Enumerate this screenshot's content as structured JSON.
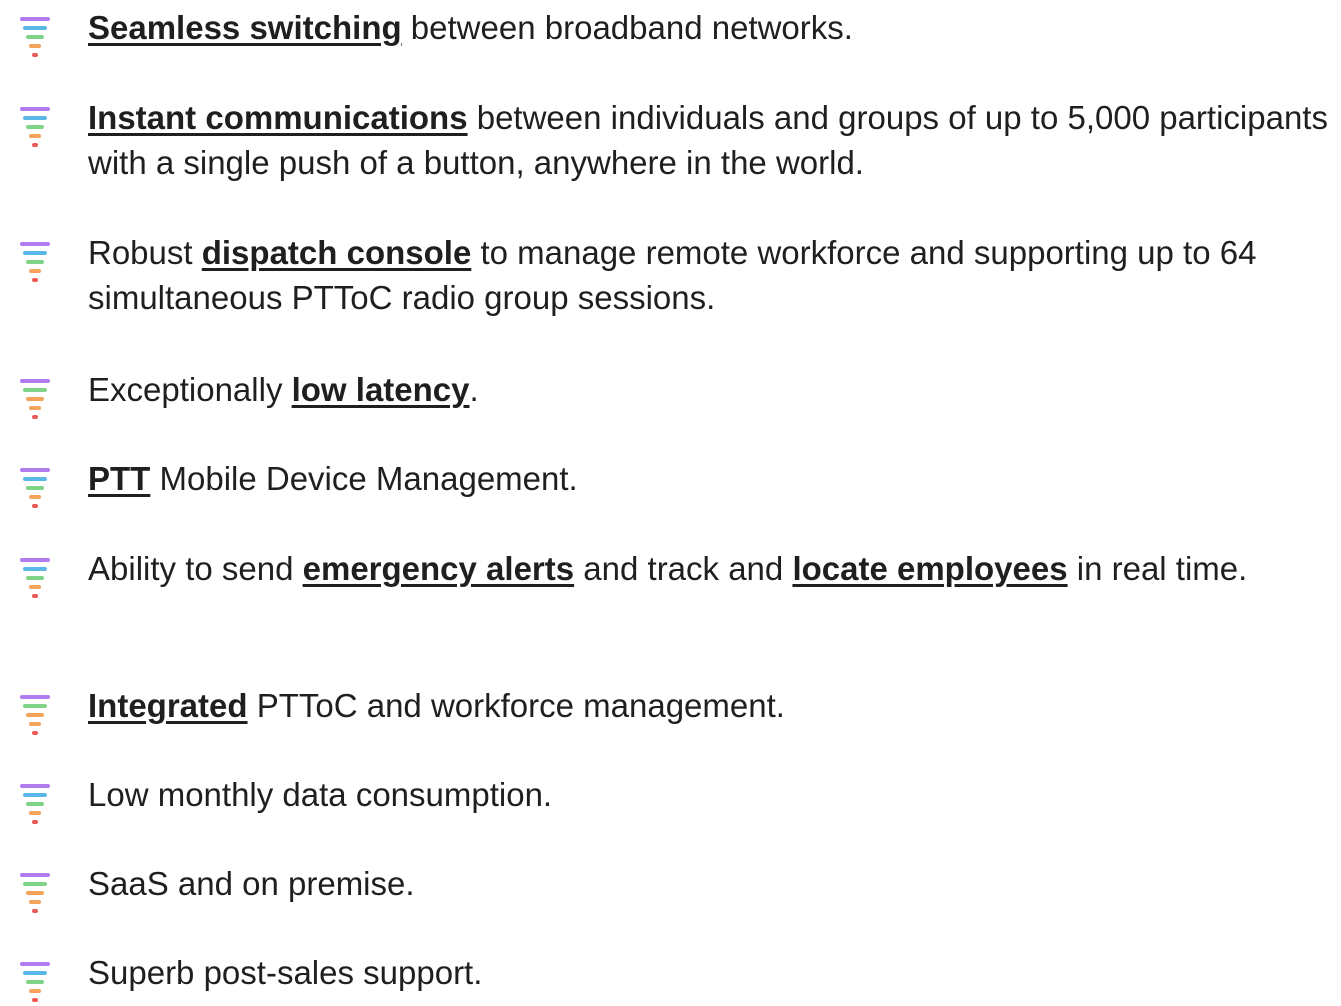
{
  "features": [
    {
      "parts": [
        {
          "text": "Seamless switching",
          "bold": true
        },
        {
          "text": " between broadband networks."
        }
      ]
    },
    {
      "parts": [
        {
          "text": "Instant communications",
          "bold": true
        },
        {
          "text": " between individuals and groups of up to 5,000 participants with a single push of a button, anywhere in the world."
        }
      ]
    },
    {
      "parts": [
        {
          "text": "Robust "
        },
        {
          "text": "dispatch console",
          "bold": true
        },
        {
          "text": " to manage remote workforce and supporting up to 64 simultaneous PTToC radio group sessions."
        }
      ]
    },
    {
      "parts": [
        {
          "text": "Exceptionally "
        },
        {
          "text": "low latency",
          "bold": true
        },
        {
          "text": "."
        }
      ]
    },
    {
      "parts": [
        {
          "text": "PTT",
          "bold": true
        },
        {
          "text": " Mobile Device Management."
        }
      ]
    },
    {
      "parts": [
        {
          "text": "Ability to send "
        },
        {
          "text": "emergency alerts",
          "bold": true
        },
        {
          "text": " and track and "
        },
        {
          "text": "locate employees",
          "bold": true
        },
        {
          "text": " in real time."
        }
      ]
    },
    {
      "parts": [
        {
          "text": "Integrated",
          "bold": true
        },
        {
          "text": " PTToC and workforce management."
        }
      ]
    },
    {
      "parts": [
        {
          "text": "Low monthly data consumption."
        }
      ]
    },
    {
      "parts": [
        {
          "text": "SaaS and on premise."
        }
      ]
    },
    {
      "parts": [
        {
          "text": "Superb post-sales support."
        }
      ]
    }
  ],
  "icon": "layered-bars-bullet-icon",
  "colors": {
    "text": "#1f1f1f",
    "bar_purple": "#b07cf0",
    "bar_blue": "#5bb7e8",
    "bar_green": "#7fd487",
    "bar_orange": "#f3a35a",
    "bar_red": "#ea5b57"
  }
}
